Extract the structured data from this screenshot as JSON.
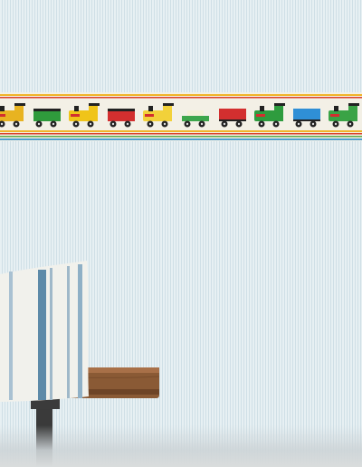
{
  "scene": {
    "subject": "train-border-wallpaper",
    "colors": {
      "wall": "#dde9ee",
      "wall_stripe": "#cfdfe6",
      "border_base": "#f3f0e6",
      "stripe_red": "#d9442f",
      "stripe_yellow": "#f0b429",
      "stripe_green": "#5aa84a",
      "stripe_blue": "#4f9fcf",
      "bench_wood": "#8a5a35",
      "pillow": "#f1f1ec",
      "pillow_stripe": "#5d8aa8"
    },
    "train_cars": [
      {
        "type": "engine",
        "color": "#e8b321"
      },
      {
        "type": "open-wagon",
        "color": "#2f9a3c"
      },
      {
        "type": "engine",
        "color": "#f0c419"
      },
      {
        "type": "open-wagon",
        "color": "#d32f2f"
      },
      {
        "type": "engine",
        "color": "#f2d13a"
      },
      {
        "type": "flatcar",
        "color": "#3da64b"
      },
      {
        "type": "boxcar",
        "color": "#d32f2f"
      },
      {
        "type": "engine",
        "color": "#2e9c3e"
      },
      {
        "type": "boxcar",
        "color": "#2f8fd6"
      },
      {
        "type": "engine",
        "color": "#3aa346"
      }
    ]
  }
}
